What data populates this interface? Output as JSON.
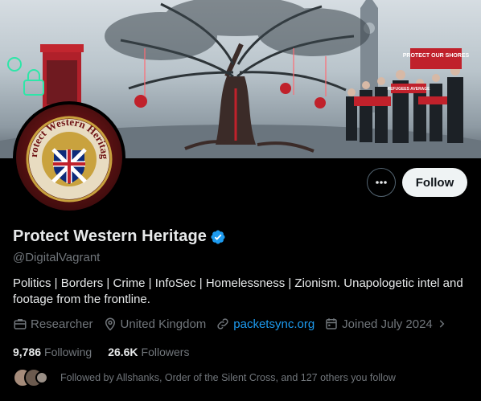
{
  "profile": {
    "display_name": "Protect Western Heritage",
    "handle": "@DigitalVagrant",
    "bio": "Politics | Borders | Crime | InfoSec | Homelessness | Zionism. Unapologetic intel and footage from the frontline.",
    "avatar_text": "Protect Western Heritage",
    "verified": true
  },
  "actions": {
    "follow_label": "Follow",
    "more_icon": "more-horizontal-icon"
  },
  "meta": {
    "occupation": "Researcher",
    "location": "United Kingdom",
    "website": "packetsync.org",
    "joined": "Joined July 2024"
  },
  "counts": {
    "following_value": "9,786",
    "following_label": "Following",
    "followers_value": "26.6K",
    "followers_label": "Followers"
  },
  "followed_by": {
    "text": "Followed by Allshanks, Order of the Silent Cross, and 127 others you follow"
  },
  "banner": {
    "placard_1": "REFUGEES AVERAGE",
    "placard_2": "PROTECT OUR SHORES"
  },
  "colors": {
    "background": "#000000",
    "text_primary": "#e7e9ea",
    "text_secondary": "#71767b",
    "link": "#1d9bf0",
    "verified_badge": "#1d9bf0",
    "follow_button_bg": "#eff3f4"
  }
}
